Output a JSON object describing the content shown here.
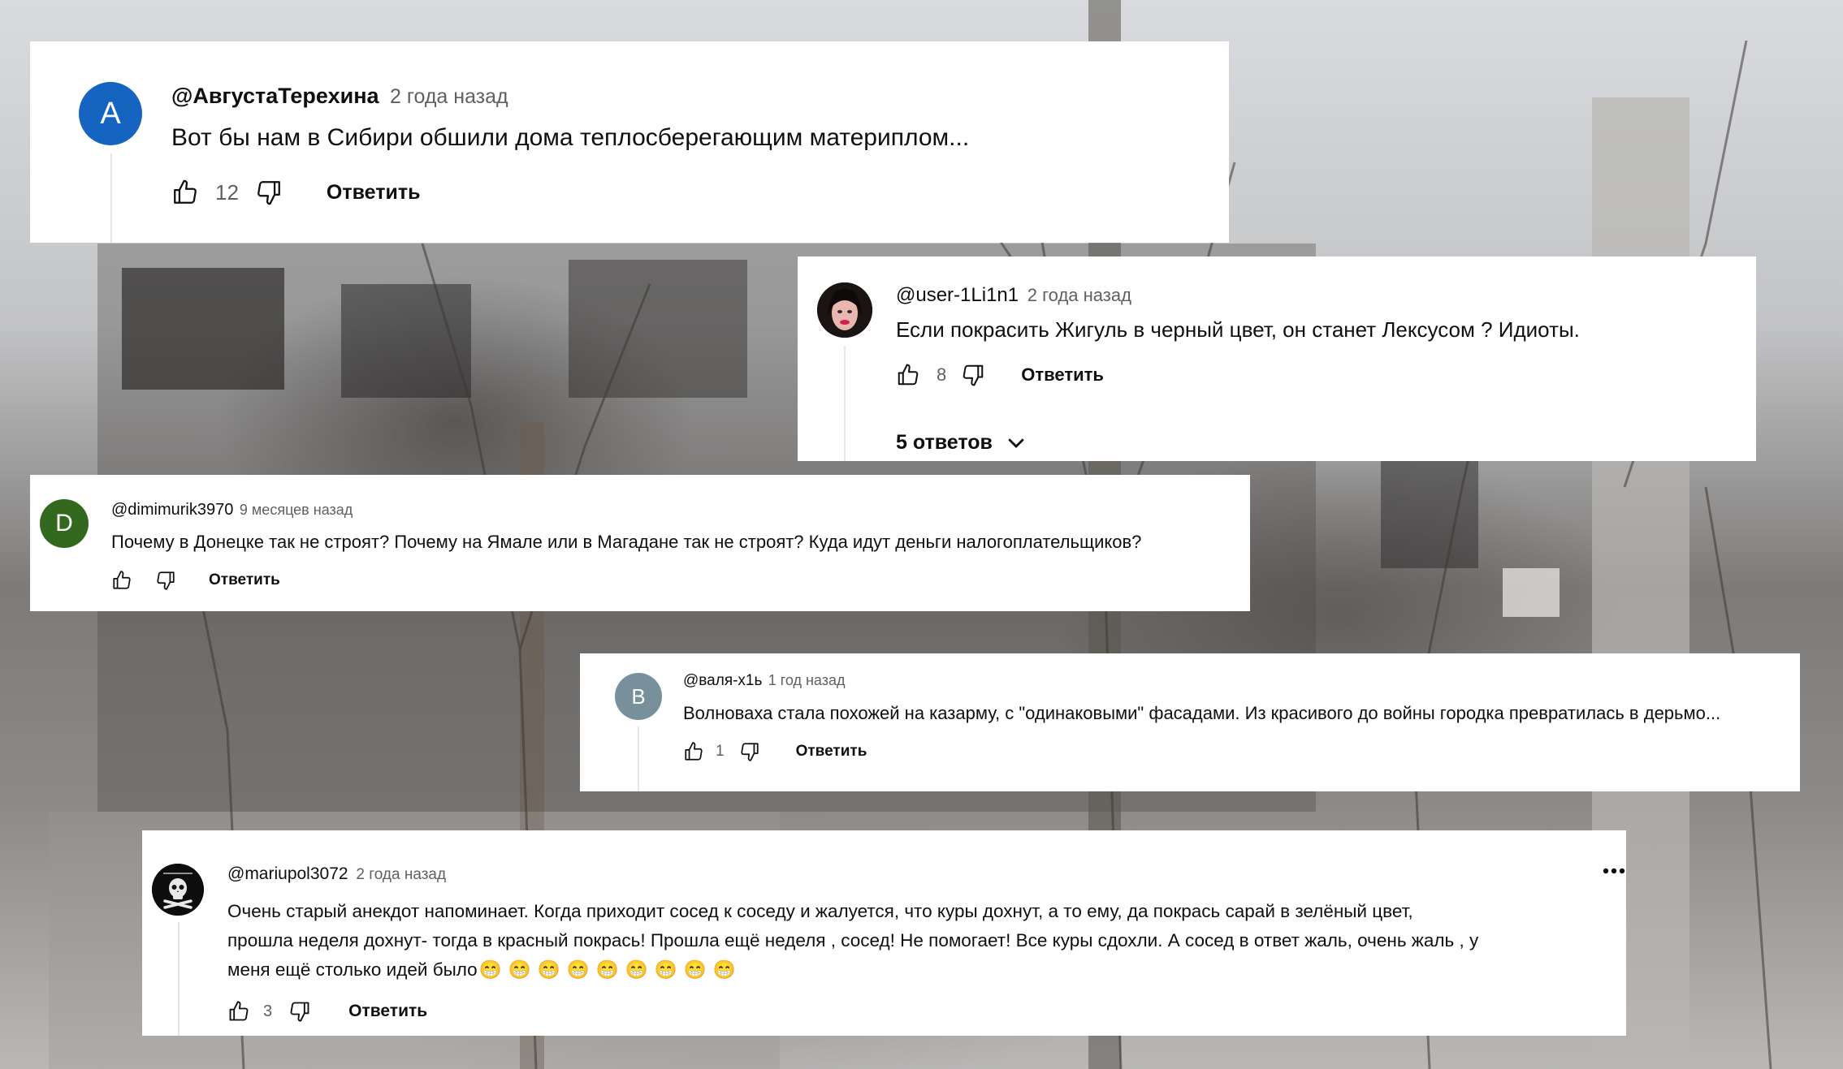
{
  "comments": [
    {
      "avatar_letter": "A",
      "avatar_color": "#1565c0",
      "author": "@АвгустаТерехина",
      "time": "2 года назад",
      "text": "Вот бы нам в Сибири обшили дома теплосберегающим материплом...",
      "likes": "12",
      "reply_label": "Ответить"
    },
    {
      "avatar_icon": "portrait-avatar",
      "author": "@user-1Li1n1",
      "time": "2 года назад",
      "text": "Если покрасить Жигуль в черный цвет, он станет Лексусом ? Идиоты.",
      "likes": "8",
      "reply_label": "Ответить",
      "replies_label": "5 ответов"
    },
    {
      "avatar_letter": "D",
      "avatar_color": "#33691e",
      "author": "@dimimurik3970",
      "time": "9 месяцев назад",
      "text": "Почему в Донецке так не строят? Почему на Ямале или в Магадане так не строят? Куда идут деньги налогоплательщиков?",
      "reply_label": "Ответить"
    },
    {
      "avatar_letter": "В",
      "avatar_color": "#78909c",
      "author": "@валя-х1ь",
      "time": "1 год назад",
      "text": "Волноваха стала похожей на казарму, с \"одинаковыми\" фасадами. Из красивого до войны городка превратилась в дерьмо...",
      "likes": "1",
      "reply_label": "Ответить"
    },
    {
      "avatar_icon": "skull-crossbones-avatar",
      "author": "@mariupol3072",
      "time": "2 года назад",
      "text_line1": "Очень старый анекдот напоминает. Когда приходит сосед к соседу и жалуется, что куры дохнут, а то ему, да покрась сарай в зелёный цвет,",
      "text_line2": "прошла неделя дохнут- тогда в красный покрась! Прошла ещё неделя , сосед! Не помогает! Все куры сдохли. А сосед в ответ жаль, очень жаль , у",
      "text_line3": "меня ещё столько идей было",
      "emoji": "😁😁😁😁😁😁😁😁😁",
      "likes": "3",
      "reply_label": "Ответить",
      "menu_icon": "more-horizontal-icon"
    }
  ]
}
